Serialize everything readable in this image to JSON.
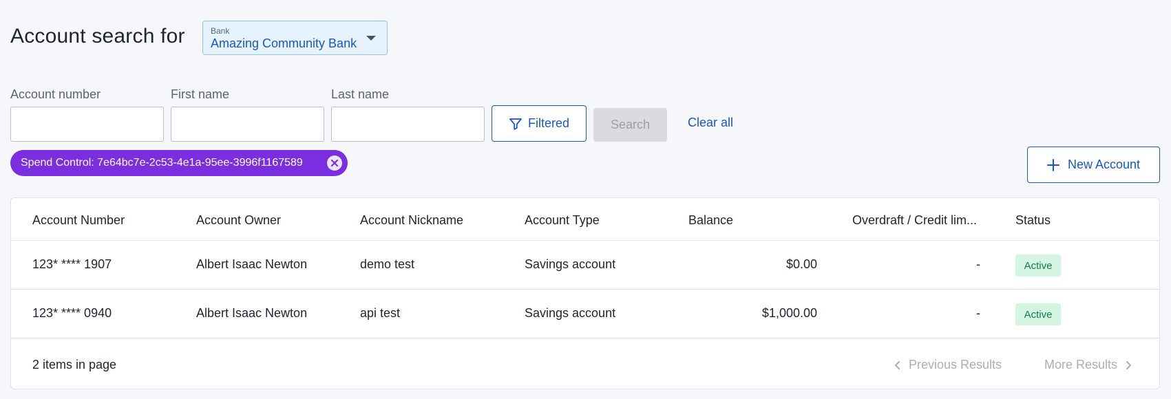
{
  "header": {
    "title": "Account search for",
    "bank_caption": "Bank",
    "bank_value": "Amazing Community Bank"
  },
  "fields": {
    "account_number_label": "Account number",
    "first_name_label": "First name",
    "last_name_label": "Last name",
    "account_number_value": "",
    "first_name_value": "",
    "last_name_value": ""
  },
  "actions": {
    "filtered_label": "Filtered",
    "search_label": "Search",
    "clear_label": "Clear all",
    "new_account_label": "New Account"
  },
  "chip": {
    "label": "Spend Control: 7e64bc7e-2c53-4e1a-95ee-3996f1167589"
  },
  "table": {
    "columns": [
      "Account Number",
      "Account Owner",
      "Account Nickname",
      "Account Type",
      "Balance",
      "Overdraft / Credit lim...",
      "Status"
    ],
    "rows": [
      {
        "number": "123* **** 1907",
        "owner": "Albert Isaac Newton",
        "nickname": "demo test",
        "type": "Savings account",
        "balance": "$0.00",
        "overdraft": "-",
        "status": "Active"
      },
      {
        "number": "123* **** 0940",
        "owner": "Albert Isaac Newton",
        "nickname": "api test",
        "type": "Savings account",
        "balance": "$1,000.00",
        "overdraft": "-",
        "status": "Active"
      }
    ],
    "footer": {
      "count": "2 items in page",
      "previous": "Previous Results",
      "next": "More Results"
    }
  },
  "colors": {
    "accent": "#1a56c9",
    "chip": "#7b2ee0",
    "active_badge_bg": "#d3f5e1",
    "active_badge_text": "#18794a"
  }
}
